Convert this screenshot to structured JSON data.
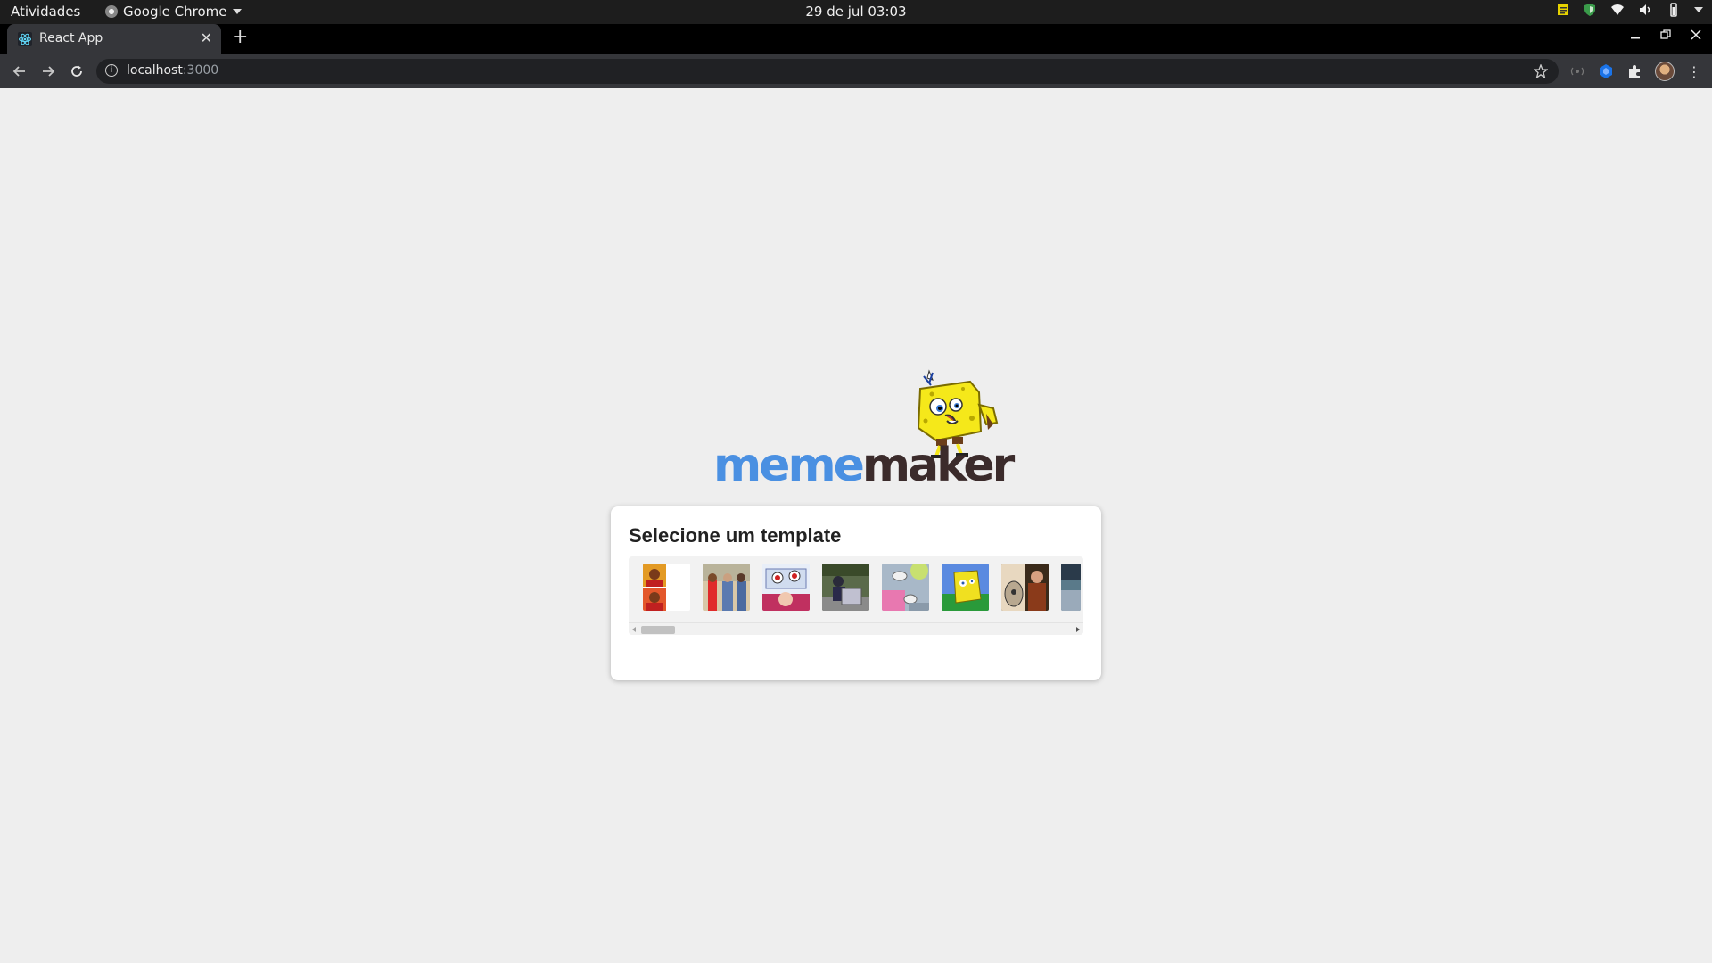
{
  "system_bar": {
    "activities": "Atividades",
    "app_name": "Google Chrome",
    "clock": "29 de jul  03:03"
  },
  "browser": {
    "tab_title": "React App",
    "new_tab_glyph": "+",
    "close_glyph": "✕",
    "address_host": "localhost",
    "address_port": ":3000"
  },
  "app": {
    "logo_part1": "meme",
    "logo_part2": "maker",
    "card_title": "Selecione um template",
    "templates": [
      {
        "name": "drake-hotline-bling"
      },
      {
        "name": "distracted-boyfriend"
      },
      {
        "name": "left-exit-12-off-ramp"
      },
      {
        "name": "guy-holding-box"
      },
      {
        "name": "bird-meme"
      },
      {
        "name": "mocking-spongebob"
      },
      {
        "name": "woman-yelling"
      },
      {
        "name": "partial-template"
      }
    ]
  },
  "colors": {
    "logo_meme": "#4a90e2",
    "logo_maker": "#3b2b2b",
    "page_bg": "#eeeeee"
  }
}
